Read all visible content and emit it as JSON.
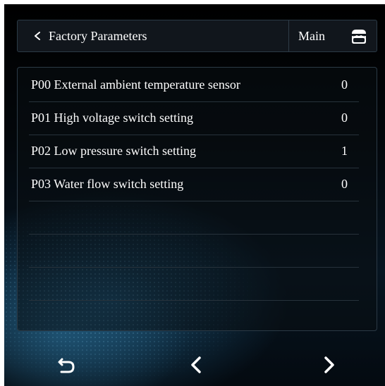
{
  "header": {
    "title": "Factory Parameters",
    "main_label": "Main"
  },
  "parameters": [
    {
      "label": "P00 External ambient temperature sensor",
      "value": "0"
    },
    {
      "label": "P01 High voltage switch setting",
      "value": "0"
    },
    {
      "label": "P02 Low pressure switch setting",
      "value": "1"
    },
    {
      "label": "P03 Water flow switch setting",
      "value": "0"
    },
    {
      "label": "",
      "value": ""
    },
    {
      "label": "",
      "value": ""
    },
    {
      "label": "",
      "value": ""
    }
  ],
  "icons": {
    "back": "chevron-left-icon",
    "home": "home-icon",
    "return": "return-icon",
    "prev": "chevron-left-icon",
    "next": "chevron-right-icon"
  },
  "colors": {
    "text": "#ffffff",
    "border": "#2b3a46",
    "background": "#000000"
  }
}
